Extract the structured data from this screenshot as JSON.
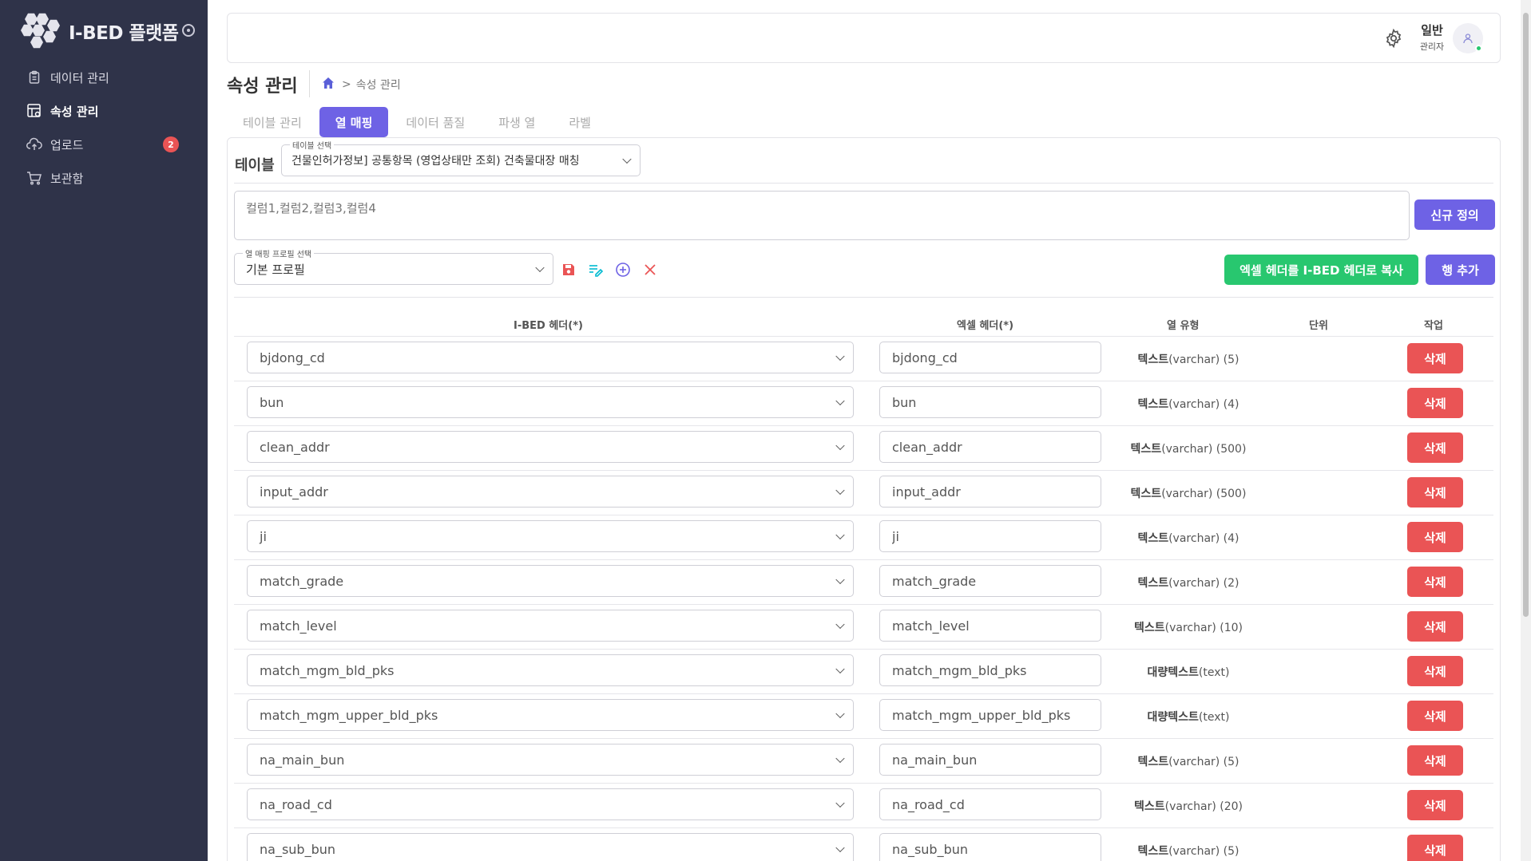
{
  "brand": {
    "name": "I-BED 플랫폼"
  },
  "sidebar": {
    "items": [
      {
        "label": "데이터 관리",
        "icon": "clipboard-icon",
        "active": false
      },
      {
        "label": "속성 관리",
        "icon": "table-settings-icon",
        "active": true
      },
      {
        "label": "업로드",
        "icon": "cloud-upload-icon",
        "active": false,
        "badge": "2"
      },
      {
        "label": "보관함",
        "icon": "cart-icon",
        "active": false
      }
    ]
  },
  "header": {
    "user_name": "일반",
    "user_role": "관리자"
  },
  "page": {
    "title": "속성 관리",
    "breadcrumb_current": "속성 관리",
    "breadcrumb_separator": ">"
  },
  "tabs": [
    {
      "label": "테이블 관리",
      "active": false
    },
    {
      "label": "열 매핑",
      "active": true
    },
    {
      "label": "데이터 품질",
      "active": false
    },
    {
      "label": "파생 열",
      "active": false
    },
    {
      "label": "라벨",
      "active": false
    }
  ],
  "mapping": {
    "table_label": "테이블",
    "table_select_legend": "테이블 선택",
    "table_select_value": "건물인허가정보] 공통항목 (영업상태만 조회) 건축물대장 매칭",
    "columns_placeholder": "컬럼1,컬럼2,컬럼3,컬럼4",
    "new_definition_button": "신규 정의",
    "profile_select_legend": "열 매핑 프로필 선택",
    "profile_select_value": "기본 프로필",
    "copy_headers_button": "엑셀 헤더를 I-BED 헤더로 복사",
    "add_row_button": "행 추가",
    "delete_label": "삭제"
  },
  "grid": {
    "headers": {
      "ibed": "I-BED 헤더(*)",
      "excel": "엑셀 헤더(*)",
      "type": "열 유형",
      "unit": "단위",
      "action": "작업"
    },
    "rows": [
      {
        "ibed": "bjdong_cd",
        "excel": "bjdong_cd",
        "type_name": "텍스트",
        "type_detail": "(varchar) (5)",
        "unit": ""
      },
      {
        "ibed": "bun",
        "excel": "bun",
        "type_name": "텍스트",
        "type_detail": "(varchar) (4)",
        "unit": ""
      },
      {
        "ibed": "clean_addr",
        "excel": "clean_addr",
        "type_name": "텍스트",
        "type_detail": "(varchar) (500)",
        "unit": ""
      },
      {
        "ibed": "input_addr",
        "excel": "input_addr",
        "type_name": "텍스트",
        "type_detail": "(varchar) (500)",
        "unit": ""
      },
      {
        "ibed": "ji",
        "excel": "ji",
        "type_name": "텍스트",
        "type_detail": "(varchar) (4)",
        "unit": ""
      },
      {
        "ibed": "match_grade",
        "excel": "match_grade",
        "type_name": "텍스트",
        "type_detail": "(varchar) (2)",
        "unit": ""
      },
      {
        "ibed": "match_level",
        "excel": "match_level",
        "type_name": "텍스트",
        "type_detail": "(varchar) (10)",
        "unit": ""
      },
      {
        "ibed": "match_mgm_bld_pks",
        "excel": "match_mgm_bld_pks",
        "type_name": "대량텍스트",
        "type_detail": "(text)",
        "unit": ""
      },
      {
        "ibed": "match_mgm_upper_bld_pks",
        "excel": "match_mgm_upper_bld_pks",
        "type_name": "대량텍스트",
        "type_detail": "(text)",
        "unit": ""
      },
      {
        "ibed": "na_main_bun",
        "excel": "na_main_bun",
        "type_name": "텍스트",
        "type_detail": "(varchar) (5)",
        "unit": ""
      },
      {
        "ibed": "na_road_cd",
        "excel": "na_road_cd",
        "type_name": "텍스트",
        "type_detail": "(varchar) (20)",
        "unit": ""
      },
      {
        "ibed": "na_sub_bun",
        "excel": "na_sub_bun",
        "type_name": "텍스트",
        "type_detail": "(varchar) (5)",
        "unit": ""
      }
    ]
  },
  "colors": {
    "sidebar_bg": "#2f3349",
    "accent": "#6e62e5",
    "success": "#28c76f",
    "danger": "#ea5455"
  }
}
